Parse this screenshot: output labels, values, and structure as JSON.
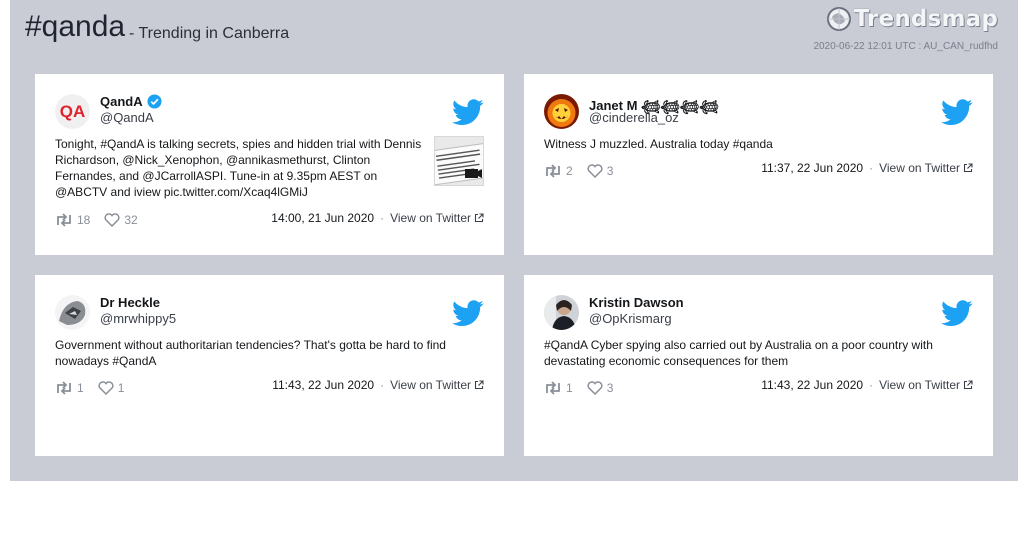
{
  "header": {
    "hashtag": "#qanda",
    "subtitle": "- Trending in Canberra",
    "logo_text": "Trendsmap",
    "meta": "2020-06-22 12:01 UTC : AU_CAN_rudfhd"
  },
  "tweets": [
    {
      "name": "QandA",
      "verified": true,
      "handle": "@QandA",
      "text": "Tonight, #QandA is talking secrets, spies and hidden trial with Dennis Richardson, @Nick_Xenophon, @annikasmethurst, Clinton Fernandes, and @JCarrollASPI. Tune-in at 9.35pm AEST on @ABCTV and iview pic.twitter.com/Xcaq4lGMiJ",
      "retweets": "18",
      "likes": "32",
      "time": "14:00, 21 Jun 2020",
      "view_label": "View on Twitter",
      "separator": "·"
    },
    {
      "name": "Janet M 𓆉𓆉𓆉𓆉",
      "verified": false,
      "handle": "@cinderella_oz",
      "text": "Witness J muzzled. Australia today #qanda",
      "retweets": "2",
      "likes": "3",
      "time": "11:37, 22 Jun 2020",
      "view_label": "View on Twitter",
      "separator": "·"
    },
    {
      "name": "Dr Heckle",
      "verified": false,
      "handle": "@mrwhippy5",
      "text": "Government without authoritarian tendencies? That's gotta be hard to find nowadays #QandA",
      "retweets": "1",
      "likes": "1",
      "time": "11:43, 22 Jun 2020",
      "view_label": "View on Twitter",
      "separator": "·"
    },
    {
      "name": "Kristin Dawson",
      "verified": false,
      "handle": "@OpKrismarg",
      "text": "#QandA Cyber spying also carried out by Australia on a poor country with devastating economic consequences for them",
      "retweets": "1",
      "likes": "3",
      "time": "11:43, 22 Jun 2020",
      "view_label": "View on Twitter",
      "separator": "·"
    }
  ],
  "colors": {
    "panel_bg": "#c9ccd4",
    "twitter_blue": "#1da1f2",
    "text": "#14171a",
    "muted": "#8a8f98"
  }
}
